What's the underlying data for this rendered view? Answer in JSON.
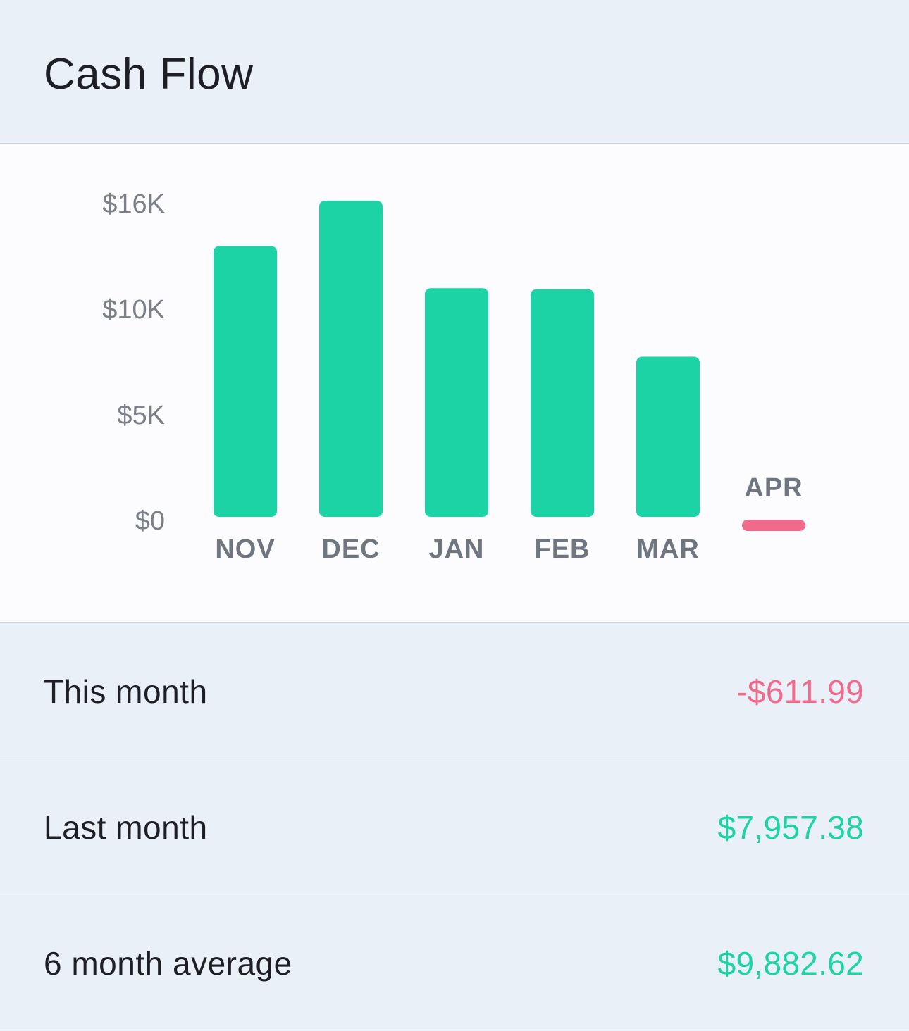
{
  "header": {
    "title": "Cash Flow"
  },
  "colors": {
    "positive": "#1bd3a4",
    "negative": "#f06a8c",
    "axis_text": "#7a7f88",
    "category_text": "#707680"
  },
  "chart_data": {
    "type": "bar",
    "categories": [
      "NOV",
      "DEC",
      "JAN",
      "FEB",
      "MAR",
      "APR"
    ],
    "values": [
      12850,
      15000,
      10850,
      10800,
      7600,
      -612
    ],
    "y_ticks": [
      "$0",
      "$5K",
      "$10K",
      "$16K"
    ],
    "y_tick_values": [
      0,
      5000,
      10000,
      15000
    ],
    "ylim": [
      0,
      15000
    ],
    "grid": false,
    "title": "",
    "xlabel": "",
    "ylabel": ""
  },
  "summary": {
    "rows": [
      {
        "label": "This month",
        "value": "-$611.99",
        "status": "negative"
      },
      {
        "label": "Last month",
        "value": "$7,957.38",
        "status": "positive"
      },
      {
        "label": "6 month average",
        "value": "$9,882.62",
        "status": "positive"
      }
    ]
  }
}
